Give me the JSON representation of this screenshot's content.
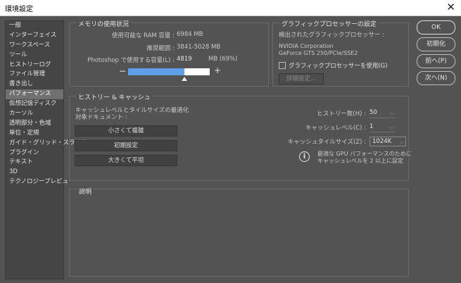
{
  "window": {
    "title": "環境設定",
    "close_glyph": "✕"
  },
  "sidebar": {
    "items": [
      {
        "label": "一般",
        "selected": false
      },
      {
        "label": "インターフェイス",
        "selected": false
      },
      {
        "label": "ワークスペース",
        "selected": false
      },
      {
        "label": "ツール",
        "selected": false
      },
      {
        "label": "ヒストリーログ",
        "selected": false
      },
      {
        "label": "ファイル管理",
        "selected": false
      },
      {
        "label": "書き出し",
        "selected": false
      },
      {
        "label": "パフォーマンス",
        "selected": true
      },
      {
        "label": "仮想記憶ディスク",
        "selected": false
      },
      {
        "label": "カーソル",
        "selected": false
      },
      {
        "label": "透明部分・色域",
        "selected": false
      },
      {
        "label": "単位・定規",
        "selected": false
      },
      {
        "label": "ガイド・グリッド・スライス",
        "selected": false
      },
      {
        "label": "プラグイン",
        "selected": false
      },
      {
        "label": "テキスト",
        "selected": false
      },
      {
        "label": "3D",
        "selected": false
      },
      {
        "label": "テクノロジープレビュー",
        "selected": false
      }
    ]
  },
  "memory": {
    "title": "メモリの使用状況",
    "ram_label": "使用可能な RAM 容量 :",
    "ram_value": "6984 MB",
    "range_label": "推奨範囲 :",
    "range_value": "3841-5028 MB",
    "use_label": "Photoshop で使用する容量(L) :",
    "use_value": "4819",
    "use_pct": "MB (69%)",
    "slider_fraction": 0.69,
    "minus": "−",
    "plus": "+"
  },
  "gpu": {
    "title": "グラフィックプロセッサーの設定",
    "detected_label": "検出されたグラフィックプロセッサー :",
    "vendor": "NVIDIA Corporation",
    "model": "GeForce GTS 250/PCIe/SSE2",
    "use_gpu_label": "グラフィックプロセッサーを使用(G)",
    "use_gpu_checked": false,
    "advanced_button": "詳細設定..."
  },
  "history": {
    "title": "ヒストリー & キャッシュ",
    "optimize_line1": "キャッシュレベルとタイルサイズの最適化",
    "optimize_line2": "対象ドキュメント :",
    "buttons": [
      "小さくて複雑",
      "初期設定",
      "大きくて平坦"
    ],
    "history_states_label": "ヒストリー数(H) :",
    "history_states_value": "50",
    "cache_levels_label": "キャッシュレベル(C) :",
    "cache_levels_value": "1",
    "cache_tile_label": "キャッシュタイルサイズ(Z) :",
    "cache_tile_value": "1024K",
    "info_line1": "最適な GPU パフォーマンスのために",
    "info_line2": "キャッシュレベルを 2 以上に設定"
  },
  "description": {
    "title": "説明"
  },
  "actions": {
    "ok": "OK",
    "reset": "初期化",
    "prev": "前へ(P)",
    "next": "次へ(N)"
  },
  "colors": {
    "accent": "#5fa0e6",
    "background": "#535353",
    "sidebar_selected": "#707070"
  }
}
